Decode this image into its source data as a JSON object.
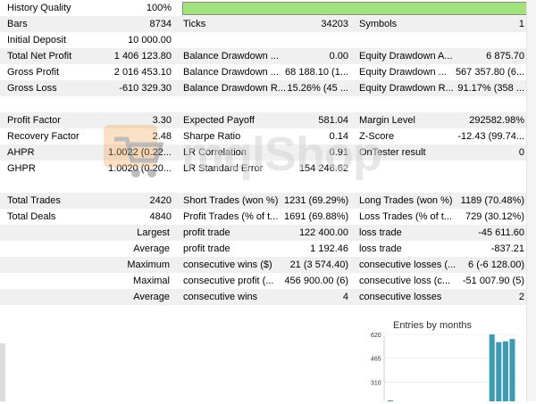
{
  "quality": {
    "label": "History Quality",
    "value": "100%",
    "fraction": 1.0
  },
  "rows": [
    {
      "top": 18,
      "shade": true,
      "cells": [
        [
          "Bars",
          "8734"
        ],
        [
          "Ticks",
          "34203"
        ],
        [
          "Symbols",
          "1"
        ]
      ]
    },
    {
      "top": 36,
      "shade": false,
      "cells": [
        [
          "Initial Deposit",
          "10 000.00"
        ],
        [
          "",
          ""
        ],
        [
          "",
          ""
        ]
      ]
    },
    {
      "top": 54,
      "shade": true,
      "cells": [
        [
          "Total Net Profit",
          "1 406 123.80"
        ],
        [
          "Balance Drawdown ...",
          "0.00"
        ],
        [
          "Equity Drawdown A...",
          "6 875.70"
        ]
      ]
    },
    {
      "top": 72,
      "shade": false,
      "cells": [
        [
          "Gross Profit",
          "2 016 453.10"
        ],
        [
          "Balance Drawdown ...",
          "68 188.10 (1..."
        ],
        [
          "Equity Drawdown ...",
          "567 357.80 (6..."
        ]
      ]
    },
    {
      "top": 90,
      "shade": true,
      "cells": [
        [
          "Gross Loss",
          "-610 329.30"
        ],
        [
          "Balance Drawdown R...",
          "15.26% (45 ..."
        ],
        [
          "Equity Drawdown R...",
          "91.17% (358 ..."
        ]
      ]
    },
    {
      "top": 126,
      "shade": true,
      "cells": [
        [
          "Profit Factor",
          "3.30"
        ],
        [
          "Expected Payoff",
          "581.04"
        ],
        [
          "Margin Level",
          "292582.98%"
        ]
      ]
    },
    {
      "top": 144,
      "shade": false,
      "cells": [
        [
          "Recovery Factor",
          "2.48"
        ],
        [
          "Sharpe Ratio",
          "0.14"
        ],
        [
          "Z-Score",
          "-12.43 (99.74..."
        ]
      ]
    },
    {
      "top": 162,
      "shade": true,
      "cells": [
        [
          "AHPR",
          "1.0022 (0.22..."
        ],
        [
          "LR Correlation",
          "0.91"
        ],
        [
          "OnTester result",
          "0"
        ]
      ]
    },
    {
      "top": 180,
      "shade": false,
      "cells": [
        [
          "GHPR",
          "1.0020 (0.20..."
        ],
        [
          "LR Standard Error",
          "154 246.62"
        ],
        [
          "",
          ""
        ]
      ]
    },
    {
      "top": 216,
      "shade": true,
      "cells": [
        [
          "Total Trades",
          "2420"
        ],
        [
          "Short Trades (won %)",
          "1231 (69.29%)"
        ],
        [
          "Long Trades (won %)",
          "1189 (70.48%)"
        ]
      ]
    },
    {
      "top": 234,
      "shade": false,
      "cells": [
        [
          "Total Deals",
          "4840"
        ],
        [
          "Profit Trades (% of t...",
          "1691 (69.88%)"
        ],
        [
          "Loss Trades (% of t...",
          "729 (30.12%)"
        ]
      ]
    }
  ],
  "rowsRight": [
    {
      "top": 252,
      "shade": true,
      "c1": "Largest",
      "cells": [
        [
          "profit trade",
          "122 400.00"
        ],
        [
          "loss trade",
          "-45 611.60"
        ]
      ]
    },
    {
      "top": 270,
      "shade": false,
      "c1": "Average",
      "cells": [
        [
          "profit trade",
          "1 192.46"
        ],
        [
          "loss trade",
          "-837.21"
        ]
      ]
    },
    {
      "top": 288,
      "shade": true,
      "c1": "Maximum",
      "cells": [
        [
          "consecutive wins ($)",
          "21 (3 574.40)"
        ],
        [
          "consecutive losses (...",
          "6 (-6 128.00)"
        ]
      ]
    },
    {
      "top": 306,
      "shade": false,
      "c1": "Maximal",
      "cells": [
        [
          "consecutive profit (...",
          "456 900.00 (6)"
        ],
        [
          "consecutive loss (c...",
          "-51 007.90 (5)"
        ]
      ]
    },
    {
      "top": 324,
      "shade": true,
      "c1": "Average",
      "cells": [
        [
          "consecutive wins",
          "4"
        ],
        [
          "consecutive losses",
          "2"
        ]
      ]
    }
  ],
  "watermark": {
    "text": "mqlShop"
  },
  "chart_data": {
    "type": "bar",
    "title": "Entries by months",
    "yticks": [
      "620",
      "465",
      "310"
    ],
    "ylim": [
      155,
      620
    ],
    "values": [
      190,
      0,
      0,
      0,
      0,
      0,
      0,
      0,
      0,
      0,
      0,
      0,
      0,
      0,
      0,
      620,
      570,
      575,
      590
    ],
    "color": "#3a9bb5"
  },
  "colors": {
    "accent": "#9fe37a",
    "shade": "#f0f0f0",
    "bar": "#3a9bb5"
  }
}
